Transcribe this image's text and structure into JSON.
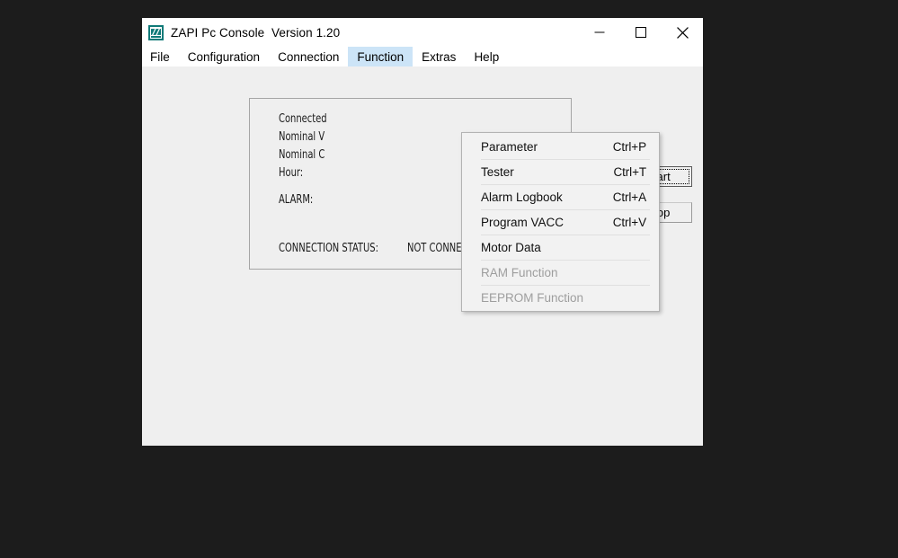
{
  "window": {
    "title": "ZAPI Pc Console  Version 1.20",
    "icon": "zapi-logo-icon",
    "icon_color": "#0f7a78",
    "controls": [
      {
        "name": "minimize",
        "glyph": "minimize-icon"
      },
      {
        "name": "maximize",
        "glyph": "maximize-icon"
      },
      {
        "name": "close",
        "glyph": "close-icon"
      }
    ]
  },
  "menubar": {
    "items": [
      {
        "label": "File",
        "active": false
      },
      {
        "label": "Configuration",
        "active": false
      },
      {
        "label": "Connection",
        "active": false
      },
      {
        "label": "Function",
        "active": true
      },
      {
        "label": "Extras",
        "active": false
      },
      {
        "label": "Help",
        "active": false
      }
    ],
    "highlight_color": "#cce4f7"
  },
  "function_menu": {
    "items": [
      {
        "label": "Parameter",
        "shortcut": "Ctrl+P",
        "disabled": false
      },
      {
        "label": "Tester",
        "shortcut": "Ctrl+T",
        "disabled": false
      },
      {
        "label": "Alarm Logbook",
        "shortcut": "Ctrl+A",
        "disabled": false
      },
      {
        "label": "Program VACC",
        "shortcut": "Ctrl+V",
        "disabled": false
      },
      {
        "label": "Motor Data",
        "shortcut": "",
        "disabled": false
      },
      {
        "label": "RAM Function",
        "shortcut": "",
        "disabled": true
      },
      {
        "label": "EEPROM Function",
        "shortcut": "",
        "disabled": true
      }
    ]
  },
  "status_panel": {
    "rows": [
      {
        "label": "Connected",
        "value": ""
      },
      {
        "label": "Nominal V",
        "value": ""
      },
      {
        "label": "Nominal C",
        "value": ""
      },
      {
        "label": "Hour:",
        "value": ""
      },
      {
        "label": "ALARM:",
        "value": ""
      }
    ],
    "connection_status_label": "CONNECTION STATUS:",
    "connection_status_value": "NOT CONNECTED"
  },
  "controls": {
    "start_label": "Start",
    "stop_label": "Stop"
  }
}
